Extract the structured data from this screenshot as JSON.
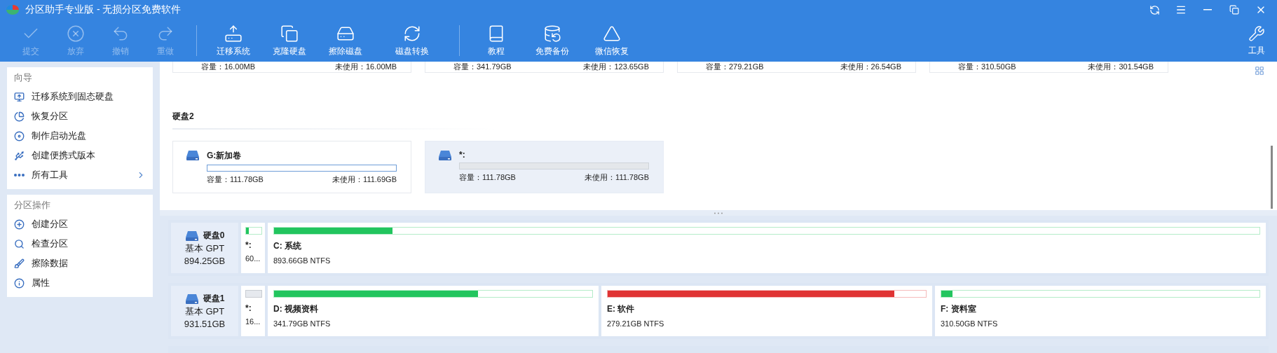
{
  "window": {
    "title": "分区助手专业版 - 无损分区免费软件"
  },
  "toolbar": {
    "groups": [
      [
        {
          "label": "提交",
          "disabled": true
        },
        {
          "label": "放弃",
          "disabled": true
        },
        {
          "label": "撤销",
          "disabled": true
        },
        {
          "label": "重做",
          "disabled": true
        }
      ],
      [
        {
          "label": "迁移系统",
          "disabled": false
        },
        {
          "label": "克隆硬盘",
          "disabled": false
        },
        {
          "label": "擦除磁盘",
          "disabled": false
        },
        {
          "label": "磁盘转换",
          "disabled": false
        }
      ],
      [
        {
          "label": "教程",
          "disabled": false
        },
        {
          "label": "免费备份",
          "disabled": false
        },
        {
          "label": "微信恢复",
          "disabled": false
        }
      ]
    ],
    "tools": {
      "label": "工具",
      "disabled": false
    }
  },
  "sidebar": {
    "sections": [
      {
        "title": "向导",
        "items": [
          {
            "label": "迁移系统到固态硬盘",
            "expandable": false
          },
          {
            "label": "恢复分区",
            "expandable": false
          },
          {
            "label": "制作启动光盘",
            "expandable": false
          },
          {
            "label": "创建便携式版本",
            "expandable": false
          },
          {
            "label": "所有工具",
            "expandable": true
          }
        ]
      },
      {
        "title": "分区操作",
        "items": [
          {
            "label": "创建分区",
            "expandable": false
          },
          {
            "label": "检查分区",
            "expandable": false
          },
          {
            "label": "擦除数据",
            "expandable": false
          },
          {
            "label": "属性",
            "expandable": false
          }
        ]
      }
    ]
  },
  "partition_cards_top": [
    {
      "capacity": "容量：16.00MB",
      "unused": "未使用：16.00MB"
    },
    {
      "capacity": "容量：341.79GB",
      "unused": "未使用：123.65GB"
    },
    {
      "capacity": "容量：279.21GB",
      "unused": "未使用：26.54GB"
    },
    {
      "capacity": "容量：310.50GB",
      "unused": "未使用：301.54GB"
    }
  ],
  "disk2": {
    "title": "硬盘2",
    "cards": [
      {
        "name": "G:新加卷",
        "kind": "partition",
        "selected": false,
        "level": 0,
        "capacity": "容量：111.78GB",
        "unused": "未使用：111.69GB"
      },
      {
        "name": "*:",
        "kind": "unallocated",
        "selected": true,
        "level": 0,
        "capacity": "容量：111.78GB",
        "unused": "未使用：111.78GB"
      }
    ]
  },
  "disks": [
    {
      "name": "硬盘0",
      "type": "基本 GPT",
      "size": "894.25GB",
      "partitions": [
        {
          "kind": "small",
          "name": "*:",
          "size": "60...",
          "level": 0.2,
          "color": "#22c55e"
        },
        {
          "kind": "partition",
          "name": "C: 系统",
          "size": "893.66GB NTFS",
          "level": 0.12,
          "color": "#22c55e"
        }
      ]
    },
    {
      "name": "硬盘1",
      "type": "基本 GPT",
      "size": "931.51GB",
      "partitions": [
        {
          "kind": "unallocated",
          "name": "*:",
          "size": "16..."
        },
        {
          "kind": "partition",
          "name": "D: 视频资料",
          "size": "341.79GB NTFS",
          "level": 0.64,
          "color": "#22c55e"
        },
        {
          "kind": "partition",
          "name": "E: 软件",
          "size": "279.21GB NTFS",
          "level": 0.9,
          "color": "#e03434"
        },
        {
          "kind": "partition",
          "name": "F: 资料室",
          "size": "310.50GB NTFS",
          "level": 0.035,
          "color": "#22c55e"
        }
      ]
    }
  ]
}
